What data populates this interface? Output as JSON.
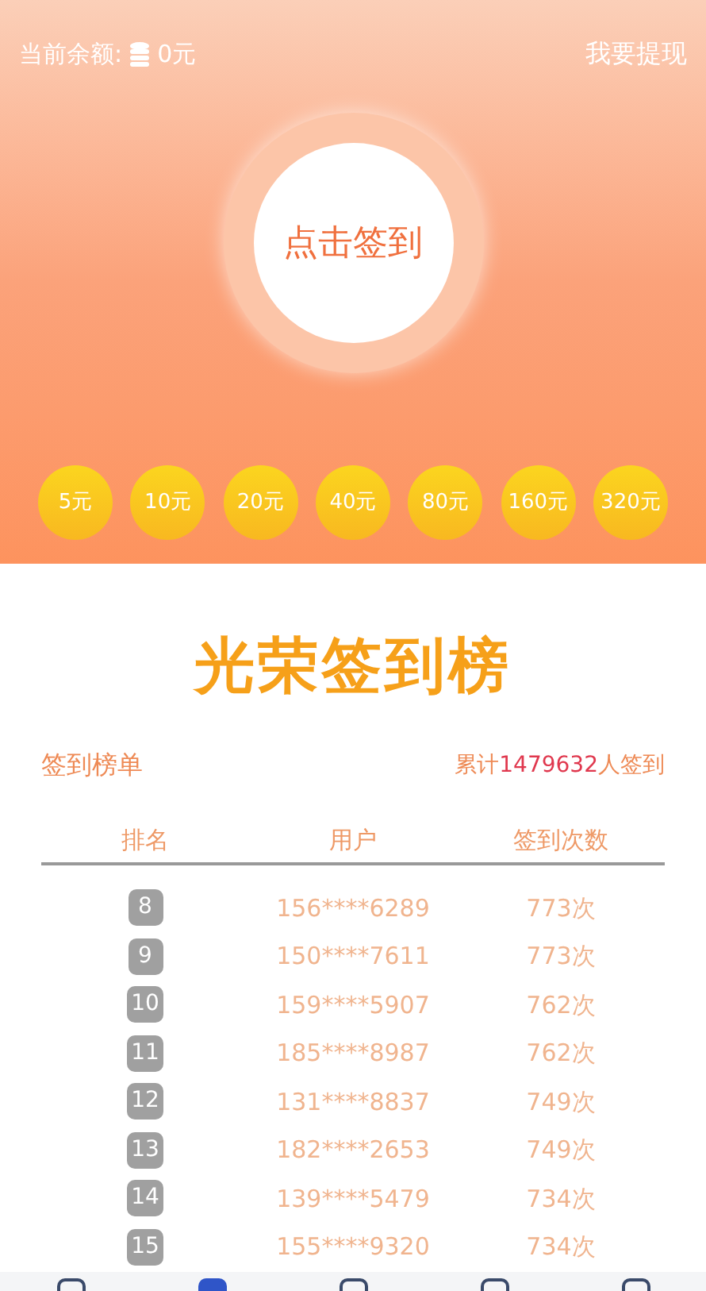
{
  "header": {
    "balance_label": "当前余额:",
    "balance_value": "0元",
    "withdraw": "我要提现",
    "checkin_button": "点击签到"
  },
  "rewards": [
    "5元",
    "10元",
    "20元",
    "40元",
    "80元",
    "160元",
    "320元"
  ],
  "banner_title": "光荣签到榜",
  "board": {
    "title": "签到榜单",
    "total_prefix": "累计",
    "total_count": "1479632",
    "total_suffix": "人签到"
  },
  "table": {
    "columns": [
      "排名",
      "用户",
      "签到次数"
    ],
    "rows": [
      {
        "rank": "8",
        "user": "156****6289",
        "count": "773次"
      },
      {
        "rank": "9",
        "user": "150****7611",
        "count": "773次"
      },
      {
        "rank": "10",
        "user": "159****5907",
        "count": "762次"
      },
      {
        "rank": "11",
        "user": "185****8987",
        "count": "762次"
      },
      {
        "rank": "12",
        "user": "131****8837",
        "count": "749次"
      },
      {
        "rank": "13",
        "user": "182****2653",
        "count": "749次"
      },
      {
        "rank": "14",
        "user": "139****5479",
        "count": "734次"
      },
      {
        "rank": "15",
        "user": "155****9320",
        "count": "734次"
      }
    ]
  },
  "tab_bar": [
    {
      "selected": false
    },
    {
      "selected": true
    },
    {
      "selected": false
    },
    {
      "selected": false
    },
    {
      "selected": false
    }
  ]
}
